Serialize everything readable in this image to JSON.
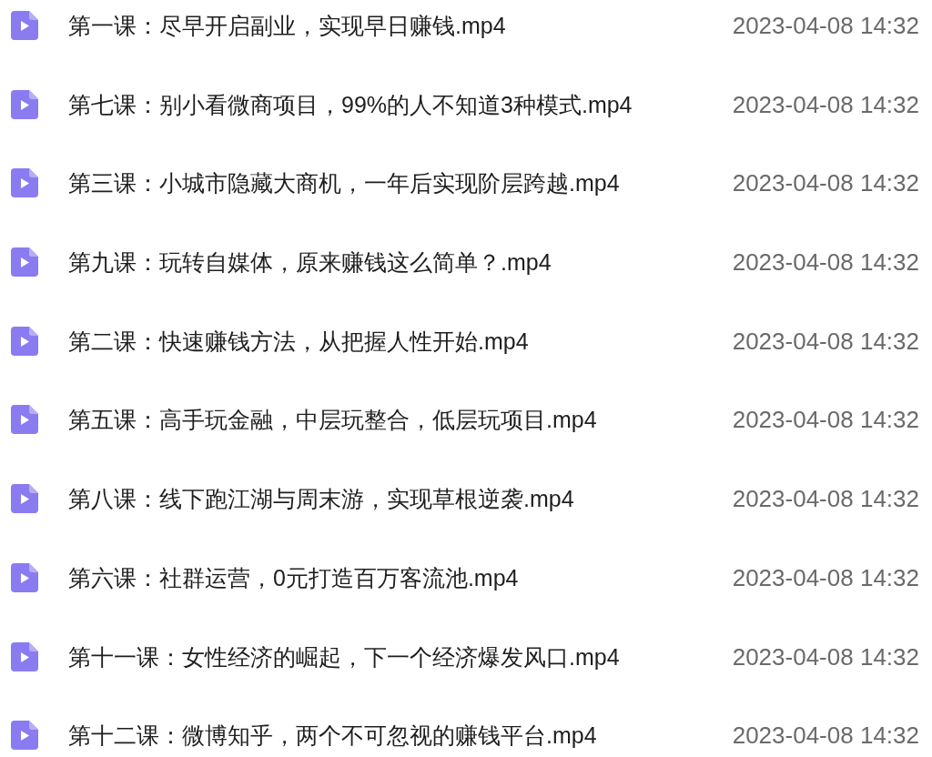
{
  "files": [
    {
      "name": "第一课：尽早开启副业，实现早日赚钱.mp4",
      "modified": "2023-04-08 14:32"
    },
    {
      "name": "第七课：别小看微商项目，99%的人不知道3种模式.mp4",
      "modified": "2023-04-08 14:32"
    },
    {
      "name": "第三课：小城市隐藏大商机，一年后实现阶层跨越.mp4",
      "modified": "2023-04-08 14:32"
    },
    {
      "name": "第九课：玩转自媒体，原来赚钱这么简单？.mp4",
      "modified": "2023-04-08 14:32"
    },
    {
      "name": "第二课：快速赚钱方法，从把握人性开始.mp4",
      "modified": "2023-04-08 14:32"
    },
    {
      "name": "第五课：高手玩金融，中层玩整合，低层玩项目.mp4",
      "modified": "2023-04-08 14:32"
    },
    {
      "name": "第八课：线下跑江湖与周末游，实现草根逆袭.mp4",
      "modified": "2023-04-08 14:32"
    },
    {
      "name": "第六课：社群运营，0元打造百万客流池.mp4",
      "modified": "2023-04-08 14:32"
    },
    {
      "name": "第十一课：女性经济的崛起，下一个经济爆发风口.mp4",
      "modified": "2023-04-08 14:32"
    },
    {
      "name": "第十二课：微博知乎，两个不可忽视的赚钱平台.mp4",
      "modified": "2023-04-08 14:32"
    }
  ]
}
